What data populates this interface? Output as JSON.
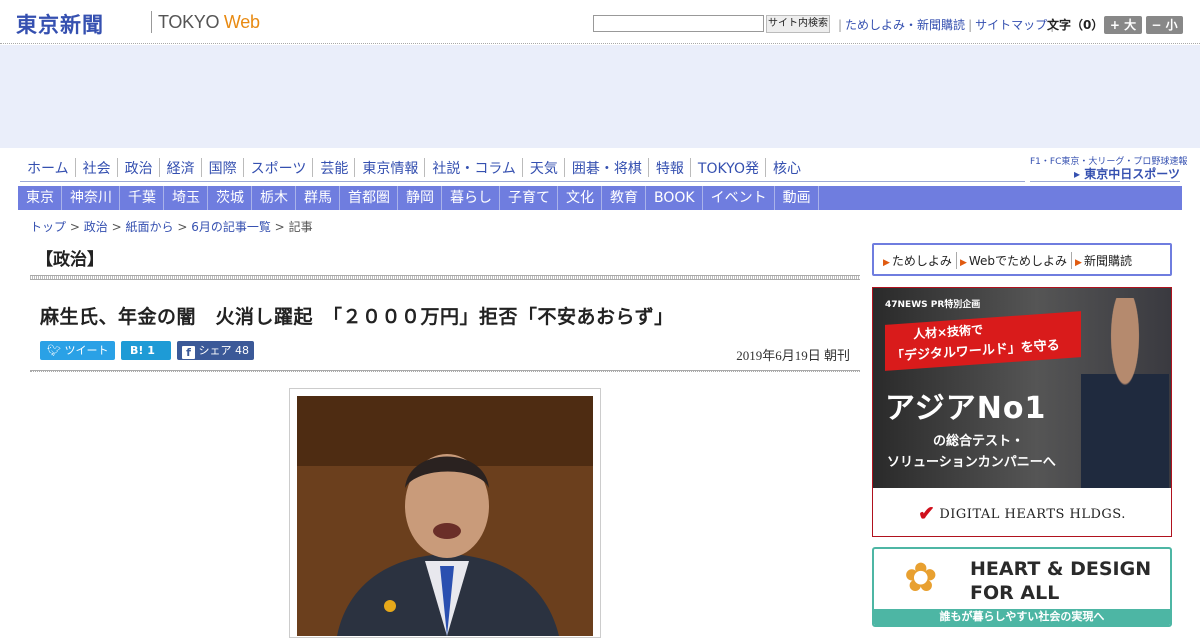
{
  "header": {
    "logo_jp": "東京新聞",
    "logo_en": "TOKYO",
    "logo_web": "Web",
    "search_button": "サイト内検索",
    "links": [
      "ためしよみ・新聞購読",
      "サイトマップ"
    ],
    "font_size_label": "文字（0）",
    "font_bigger": "+ 大",
    "font_smaller": "− 小"
  },
  "nav_main": [
    "ホーム",
    "社会",
    "政治",
    "経済",
    "国際",
    "スポーツ",
    "芸能",
    "東京情報",
    "社説・コラム",
    "天気",
    "囲碁・将棋",
    "特報",
    "TOKYO発",
    "核心"
  ],
  "sports_link": {
    "top": "F1・FC東京・大リーグ・プロ野球速報",
    "name": "▸ 東京中日スポーツ"
  },
  "nav_regional": [
    "東京",
    "神奈川",
    "千葉",
    "埼玉",
    "茨城",
    "栃木",
    "群馬",
    "首都圏",
    "静岡",
    "暮らし",
    "子育て",
    "文化",
    "教育",
    "BOOK",
    "イベント",
    "動画"
  ],
  "breadcrumb": {
    "items": [
      "トップ",
      "政治",
      "紙面から",
      "6月の記事一覧"
    ],
    "separator": ">",
    "current": "記事"
  },
  "article": {
    "category": "【政治】",
    "headline": "麻生氏、年金の闇　火消し躍起　「２０００万円」拒否「不安あおらず」",
    "date": "2019年6月19日 朝刊",
    "share": {
      "tweet": "ツイート",
      "hatena": "B! 1",
      "facebook": "シェア",
      "facebook_count": "48"
    }
  },
  "sidebar": {
    "links": [
      "ためしよみ",
      "Webでためしよみ",
      "新聞購読"
    ],
    "ad1": {
      "label": "47NEWS PR特別企画",
      "line1": "人材×技術で",
      "line2": "「デジタルワールド」を守る",
      "big": "アジアNo1",
      "line3": "の総合テスト・",
      "line4": "ソリューションカンパニーへ",
      "brand": "DIGITAL HEARTS HLDGS."
    },
    "ad2": {
      "line1": "HEART & DESIGN",
      "line2": "FOR ALL",
      "tagline": "誰もが暮らしやすい社会の実現へ"
    }
  },
  "colors": {
    "accent": "#3550b0",
    "regional_nav": "#6f7ddf",
    "twitter": "#2aa1e6",
    "hatena": "#1e9bd6",
    "facebook": "#3b5998",
    "ad_red": "#d91b1b",
    "ad_teal": "#4db6a4"
  }
}
